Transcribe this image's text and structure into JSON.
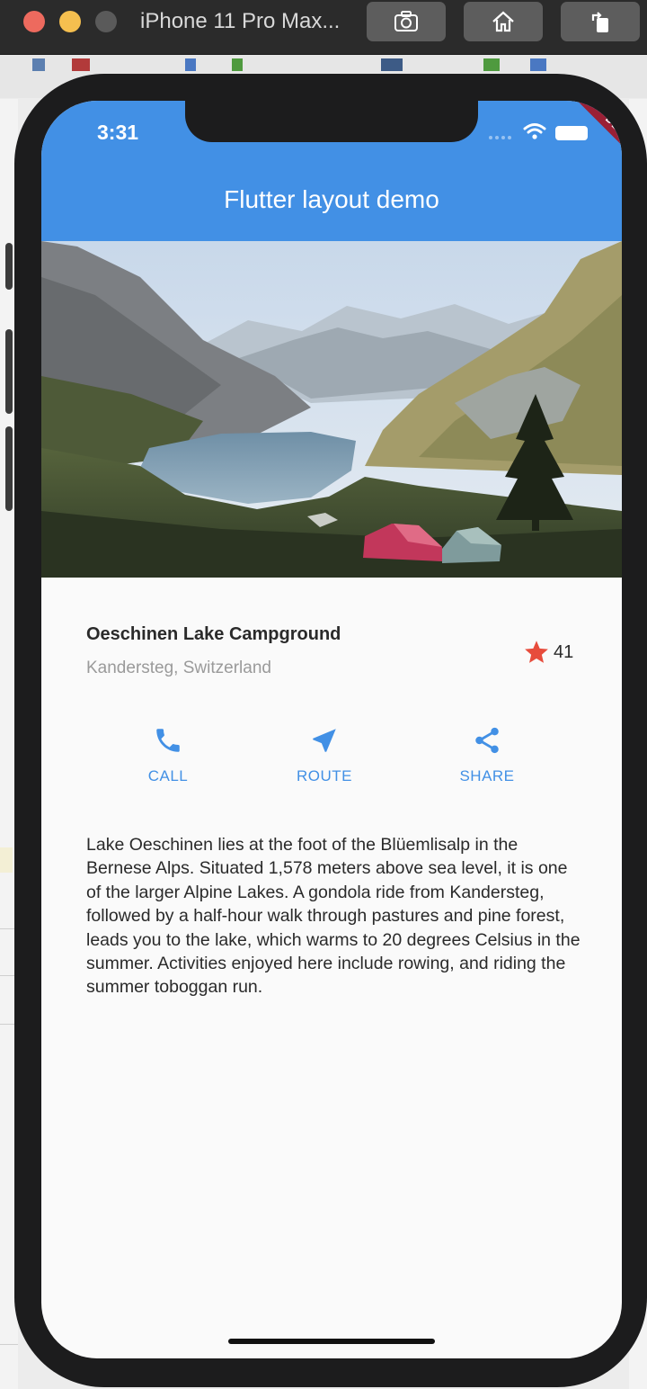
{
  "simulator": {
    "title": "iPhone 11 Pro Max..."
  },
  "status_bar": {
    "time": "3:31",
    "debug_banner": "DEBUG"
  },
  "app_bar": {
    "title": "Flutter layout demo"
  },
  "place": {
    "name": "Oeschinen Lake Campground",
    "location": "Kandersteg, Switzerland",
    "rating_count": "41"
  },
  "actions": [
    {
      "label": "CALL",
      "icon": "phone-icon"
    },
    {
      "label": "ROUTE",
      "icon": "navigation-icon"
    },
    {
      "label": "SHARE",
      "icon": "share-icon"
    }
  ],
  "description": "Lake Oeschinen lies at the foot of the Blüemlisalp in the Bernese Alps. Situated 1,578 meters above sea level, it is one of the larger Alpine Lakes. A gondola ride from Kandersteg, followed by a half-hour walk through pastures and pine forest, leads you to the lake, which warms to 20 degrees Celsius in the summer. Activities enjoyed here include rowing, and riding the summer toboggan run.",
  "colors": {
    "primary": "#4290e5",
    "star": "#e74c3c",
    "debug": "#9a2035"
  }
}
